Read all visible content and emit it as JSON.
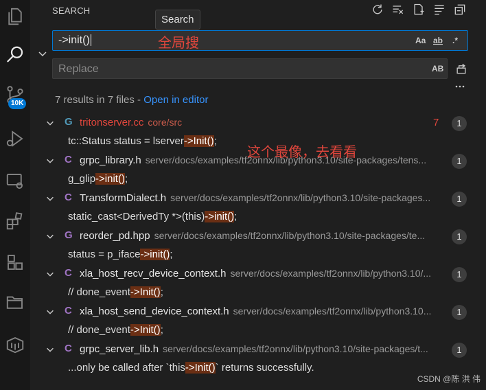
{
  "panel": {
    "title": "SEARCH",
    "tooltip": "Search",
    "search_value": "->init()",
    "search_annotation": "全局搜",
    "search_options": [
      "Aa",
      "ab",
      ".*"
    ],
    "replace_placeholder": "Replace",
    "replace_option": "AB",
    "summary_text": "7 results in 7 files - ",
    "summary_link": "Open in editor",
    "annotation_best": "这个最像，去看看",
    "activity_badge": "10K"
  },
  "results": [
    {
      "icon": "G",
      "icon_color": "#519aba",
      "name": "tritonserver.cc",
      "name_color": "#e0463c",
      "path": "core/src",
      "path_color": "#c95b4b",
      "problems": "7",
      "count": "1",
      "before": "tc::Status status = lserver",
      "match": "->Init()",
      "after": ";"
    },
    {
      "icon": "C",
      "icon_color": "#a074c4",
      "name": "grpc_library.h",
      "path": "server/docs/examples/tf2onnx/lib/python3.10/site-packages/tens...",
      "count": "1",
      "before": "g_glip",
      "match": "->init()",
      "after": ";"
    },
    {
      "icon": "C",
      "icon_color": "#a074c4",
      "name": "TransformDialect.h",
      "path": "server/docs/examples/tf2onnx/lib/python3.10/site-packages...",
      "count": "1",
      "before": "static_cast<DerivedTy *>(this)",
      "match": "->init()",
      "after": ";"
    },
    {
      "icon": "G",
      "icon_color": "#a074c4",
      "name": "reorder_pd.hpp",
      "path": "server/docs/examples/tf2onnx/lib/python3.10/site-packages/te...",
      "count": "1",
      "before": "status = p_iface",
      "match": "->init()",
      "after": ";"
    },
    {
      "icon": "C",
      "icon_color": "#a074c4",
      "name": "xla_host_recv_device_context.h",
      "path": "server/docs/examples/tf2onnx/lib/python3.10/...",
      "count": "1",
      "before": "//  done_event",
      "match": "->Init()",
      "after": ";"
    },
    {
      "icon": "C",
      "icon_color": "#a074c4",
      "name": "xla_host_send_device_context.h",
      "path": "server/docs/examples/tf2onnx/lib/python3.10...",
      "count": "1",
      "before": "//  done_event",
      "match": "->Init()",
      "after": ";"
    },
    {
      "icon": "C",
      "icon_color": "#a074c4",
      "name": "grpc_server_lib.h",
      "path": "server/docs/examples/tf2onnx/lib/python3.10/site-packages/t...",
      "count": "1",
      "before": "...only be called after `this",
      "match": "->Init()",
      "after": "` returns successfully."
    }
  ],
  "watermark": "CSDN @陈 洪 伟",
  "colors": {
    "accent": "#0078d4",
    "background": "#1f1f1f",
    "match_highlight": "#6b2f14",
    "annotation": "#e0463c"
  }
}
